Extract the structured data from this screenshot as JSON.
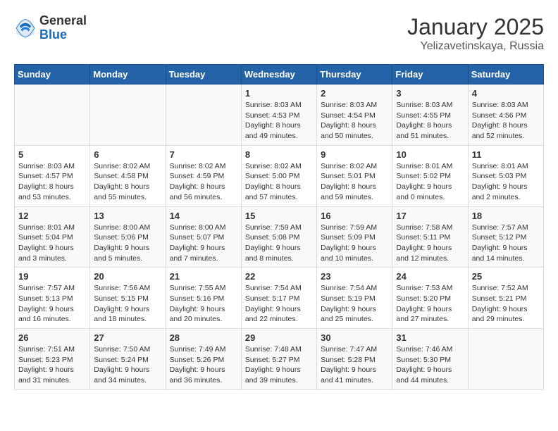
{
  "logo": {
    "general": "General",
    "blue": "Blue"
  },
  "title": "January 2025",
  "subtitle": "Yelizavetinskaya, Russia",
  "days": [
    "Sunday",
    "Monday",
    "Tuesday",
    "Wednesday",
    "Thursday",
    "Friday",
    "Saturday"
  ],
  "weeks": [
    [
      {
        "day": "",
        "content": ""
      },
      {
        "day": "",
        "content": ""
      },
      {
        "day": "",
        "content": ""
      },
      {
        "day": "1",
        "content": "Sunrise: 8:03 AM\nSunset: 4:53 PM\nDaylight: 8 hours\nand 49 minutes."
      },
      {
        "day": "2",
        "content": "Sunrise: 8:03 AM\nSunset: 4:54 PM\nDaylight: 8 hours\nand 50 minutes."
      },
      {
        "day": "3",
        "content": "Sunrise: 8:03 AM\nSunset: 4:55 PM\nDaylight: 8 hours\nand 51 minutes."
      },
      {
        "day": "4",
        "content": "Sunrise: 8:03 AM\nSunset: 4:56 PM\nDaylight: 8 hours\nand 52 minutes."
      }
    ],
    [
      {
        "day": "5",
        "content": "Sunrise: 8:03 AM\nSunset: 4:57 PM\nDaylight: 8 hours\nand 53 minutes."
      },
      {
        "day": "6",
        "content": "Sunrise: 8:02 AM\nSunset: 4:58 PM\nDaylight: 8 hours\nand 55 minutes."
      },
      {
        "day": "7",
        "content": "Sunrise: 8:02 AM\nSunset: 4:59 PM\nDaylight: 8 hours\nand 56 minutes."
      },
      {
        "day": "8",
        "content": "Sunrise: 8:02 AM\nSunset: 5:00 PM\nDaylight: 8 hours\nand 57 minutes."
      },
      {
        "day": "9",
        "content": "Sunrise: 8:02 AM\nSunset: 5:01 PM\nDaylight: 8 hours\nand 59 minutes."
      },
      {
        "day": "10",
        "content": "Sunrise: 8:01 AM\nSunset: 5:02 PM\nDaylight: 9 hours\nand 0 minutes."
      },
      {
        "day": "11",
        "content": "Sunrise: 8:01 AM\nSunset: 5:03 PM\nDaylight: 9 hours\nand 2 minutes."
      }
    ],
    [
      {
        "day": "12",
        "content": "Sunrise: 8:01 AM\nSunset: 5:04 PM\nDaylight: 9 hours\nand 3 minutes."
      },
      {
        "day": "13",
        "content": "Sunrise: 8:00 AM\nSunset: 5:06 PM\nDaylight: 9 hours\nand 5 minutes."
      },
      {
        "day": "14",
        "content": "Sunrise: 8:00 AM\nSunset: 5:07 PM\nDaylight: 9 hours\nand 7 minutes."
      },
      {
        "day": "15",
        "content": "Sunrise: 7:59 AM\nSunset: 5:08 PM\nDaylight: 9 hours\nand 8 minutes."
      },
      {
        "day": "16",
        "content": "Sunrise: 7:59 AM\nSunset: 5:09 PM\nDaylight: 9 hours\nand 10 minutes."
      },
      {
        "day": "17",
        "content": "Sunrise: 7:58 AM\nSunset: 5:11 PM\nDaylight: 9 hours\nand 12 minutes."
      },
      {
        "day": "18",
        "content": "Sunrise: 7:57 AM\nSunset: 5:12 PM\nDaylight: 9 hours\nand 14 minutes."
      }
    ],
    [
      {
        "day": "19",
        "content": "Sunrise: 7:57 AM\nSunset: 5:13 PM\nDaylight: 9 hours\nand 16 minutes."
      },
      {
        "day": "20",
        "content": "Sunrise: 7:56 AM\nSunset: 5:15 PM\nDaylight: 9 hours\nand 18 minutes."
      },
      {
        "day": "21",
        "content": "Sunrise: 7:55 AM\nSunset: 5:16 PM\nDaylight: 9 hours\nand 20 minutes."
      },
      {
        "day": "22",
        "content": "Sunrise: 7:54 AM\nSunset: 5:17 PM\nDaylight: 9 hours\nand 22 minutes."
      },
      {
        "day": "23",
        "content": "Sunrise: 7:54 AM\nSunset: 5:19 PM\nDaylight: 9 hours\nand 25 minutes."
      },
      {
        "day": "24",
        "content": "Sunrise: 7:53 AM\nSunset: 5:20 PM\nDaylight: 9 hours\nand 27 minutes."
      },
      {
        "day": "25",
        "content": "Sunrise: 7:52 AM\nSunset: 5:21 PM\nDaylight: 9 hours\nand 29 minutes."
      }
    ],
    [
      {
        "day": "26",
        "content": "Sunrise: 7:51 AM\nSunset: 5:23 PM\nDaylight: 9 hours\nand 31 minutes."
      },
      {
        "day": "27",
        "content": "Sunrise: 7:50 AM\nSunset: 5:24 PM\nDaylight: 9 hours\nand 34 minutes."
      },
      {
        "day": "28",
        "content": "Sunrise: 7:49 AM\nSunset: 5:26 PM\nDaylight: 9 hours\nand 36 minutes."
      },
      {
        "day": "29",
        "content": "Sunrise: 7:48 AM\nSunset: 5:27 PM\nDaylight: 9 hours\nand 39 minutes."
      },
      {
        "day": "30",
        "content": "Sunrise: 7:47 AM\nSunset: 5:28 PM\nDaylight: 9 hours\nand 41 minutes."
      },
      {
        "day": "31",
        "content": "Sunrise: 7:46 AM\nSunset: 5:30 PM\nDaylight: 9 hours\nand 44 minutes."
      },
      {
        "day": "",
        "content": ""
      }
    ]
  ]
}
